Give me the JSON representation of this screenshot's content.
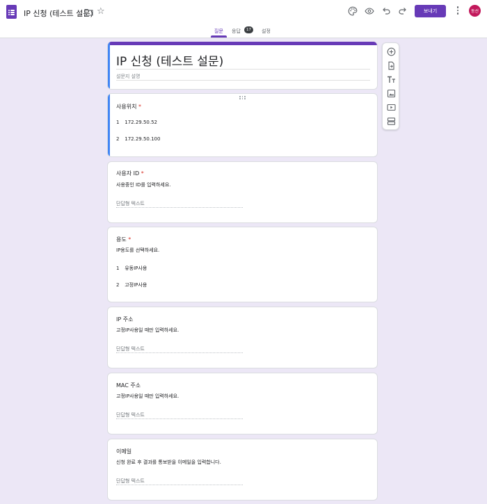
{
  "header": {
    "doc_title": "IP 신청 (테스트 설문)",
    "send_label": "보내기",
    "avatar_text": "동선",
    "accent_color": "#673ab7",
    "icons": [
      "forms-app-icon",
      "folder-icon",
      "star-icon",
      "palette-icon",
      "preview-eye-icon",
      "undo-icon",
      "redo-icon",
      "more-vert-icon"
    ]
  },
  "tabs": [
    {
      "label": "질문",
      "active": true
    },
    {
      "label": "응답",
      "badge": "17"
    },
    {
      "label": "설정"
    }
  ],
  "form": {
    "title": "IP 신청 (테스트 설문)",
    "description_placeholder": "설문지 설명"
  },
  "questions": [
    {
      "title": "사용위치",
      "required": "*",
      "options": [
        {
          "num": "1",
          "label": "172.29.50.52"
        },
        {
          "num": "2",
          "label": "172.29.50.100"
        }
      ]
    },
    {
      "title": "사용자 ID",
      "required": "*",
      "help": "사용중인 ID를 입력하세요.",
      "answer_placeholder": "단답형 텍스트"
    },
    {
      "title": "용도",
      "required": "*",
      "help": "IP용도를 선택하세요.",
      "options": [
        {
          "num": "1",
          "label": "유동IP사용"
        },
        {
          "num": "2",
          "label": "고정IP사용"
        }
      ]
    },
    {
      "title": "IP 주소",
      "help": "고정IP사용일 때만 입력하세요.",
      "answer_placeholder": "단답형 텍스트"
    },
    {
      "title": "MAC 주소",
      "help": "고정IP사용일 때만 입력하세요.",
      "answer_placeholder": "단답형 텍스트"
    },
    {
      "title": "이메일",
      "help": "신청 완료 후 결과를 통보받을 이메일을 입력합니다.",
      "answer_placeholder": "단답형 텍스트"
    }
  ],
  "side_toolbar": {
    "icons": [
      "add-question-icon",
      "import-questions-icon",
      "add-title-icon",
      "add-image-icon",
      "add-video-icon",
      "add-section-icon"
    ]
  }
}
